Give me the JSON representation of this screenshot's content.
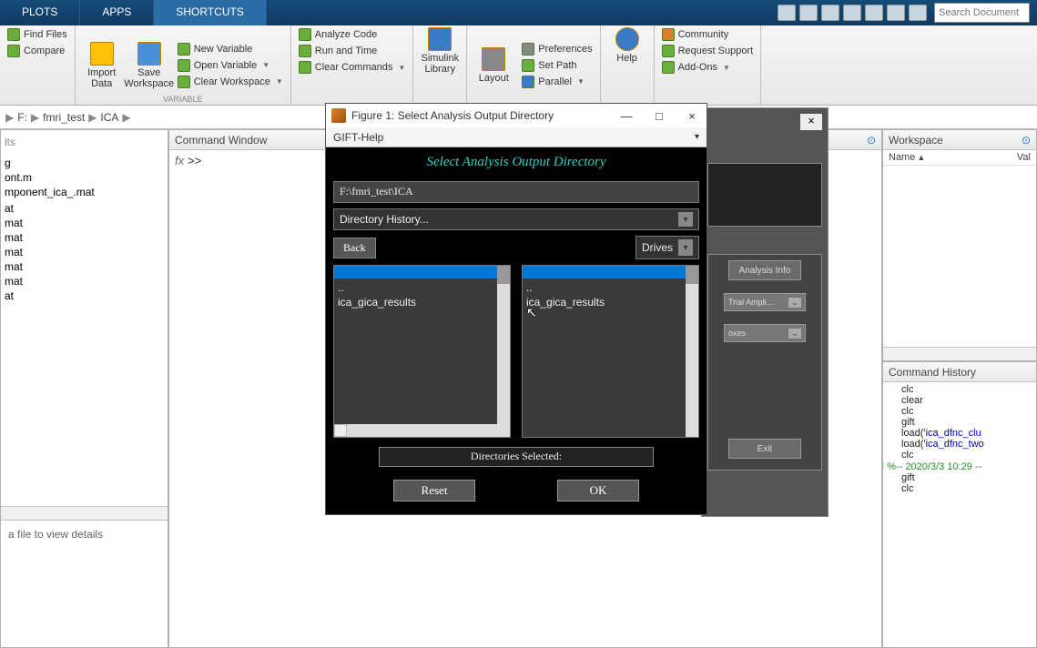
{
  "top_tabs": {
    "plots": "PLOTS",
    "apps": "APPS",
    "shortcuts": "SHORTCUTS"
  },
  "search_placeholder": "Search Document",
  "toolstrip": {
    "find_files": "Find Files",
    "compare": "Compare",
    "import_data": "Import\nData",
    "save_ws": "Save\nWorkspace",
    "new_var": "New Variable",
    "open_var": "Open Variable",
    "clear_ws": "Clear Workspace",
    "analyze": "Analyze Code",
    "run_time": "Run and Time",
    "clear_cmd": "Clear Commands",
    "simulink": "Simulink\nLibrary",
    "layout": "Layout",
    "prefs": "Preferences",
    "set_path": "Set Path",
    "parallel": "Parallel",
    "help": "Help",
    "community": "Community",
    "support": "Request Support",
    "addons": "Add-Ons",
    "group_variable": "VARIABLE"
  },
  "breadcrumb": {
    "drive": "F:",
    "p1": "fmri_test",
    "p2": "ICA"
  },
  "panels": {
    "command_window": "Command Window",
    "workspace": "Workspace",
    "command_history": "Command History",
    "name_col": "Name",
    "val_col": "Val"
  },
  "files": {
    "hint": "lts",
    "items": [
      "g",
      "ont.m",
      "mponent_ica_.mat",
      "",
      "at",
      "mat",
      "mat",
      "mat",
      "mat",
      "mat",
      "at"
    ]
  },
  "details_hint": "a file to view details",
  "prompt": ">>",
  "history": {
    "items": [
      "clc",
      "clear",
      "clc",
      "gift"
    ],
    "load1": "load('ica_dfnc_clu",
    "load2": "load('ica_dfnc_two",
    "clc2": "clc",
    "date": "%-- 2020/3/3 10:29 --",
    "gift2": "gift",
    "clc3": "clc"
  },
  "gift_bg": {
    "analysis_info": "Analysis Info",
    "trial_ampl": "Trial Ampli…",
    "boxes": "oxes",
    "exit": "Exit"
  },
  "dialog": {
    "title": "Figure 1: Select Analysis Output Directory",
    "menu": "GIFT-Help",
    "heading": "Select Analysis Output Directory",
    "path": "F:\\fmri_test\\ICA",
    "dir_history": "Directory History...",
    "back": "Back",
    "drives": "Drives",
    "list_dotdot": "..",
    "list_item": "ica_gica_results",
    "status": "Directories Selected:",
    "reset": "Reset",
    "ok": "OK"
  }
}
